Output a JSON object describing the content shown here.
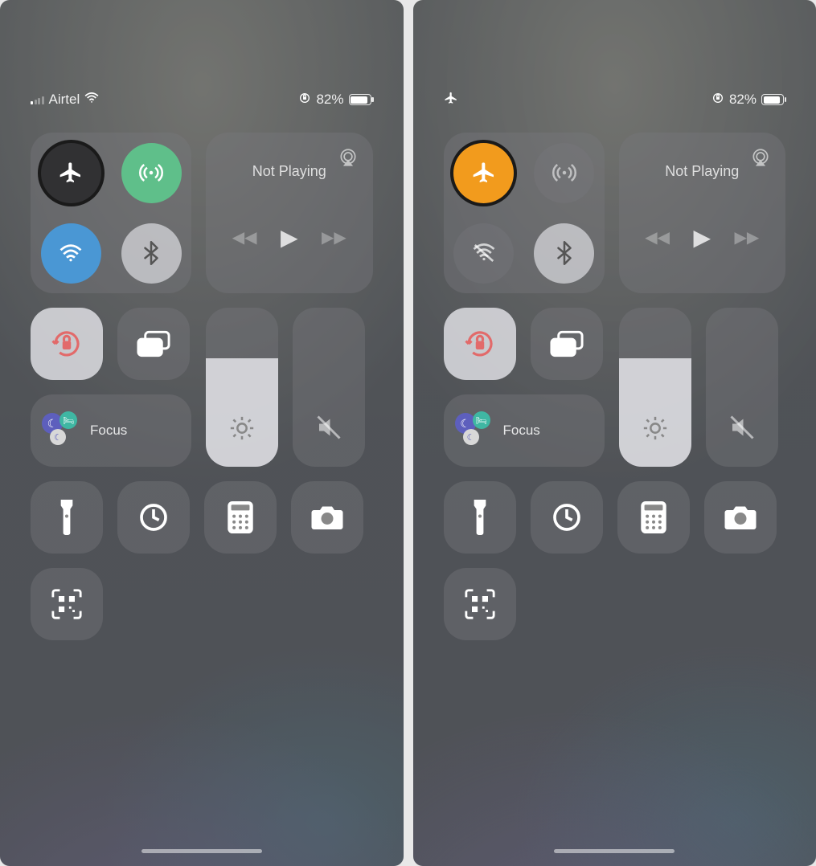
{
  "panes": [
    {
      "status": {
        "carrier": "Airtel",
        "showSignal": true,
        "battery": "82%",
        "airplaneOn": false
      },
      "media": {
        "title": "Not Playing"
      },
      "airplane": {
        "on": false
      },
      "cellular": {
        "on": true
      },
      "wifi": {
        "on": true
      },
      "bluetooth": {
        "on": true
      },
      "focus": {
        "label": "Focus"
      },
      "brightnessPct": 68,
      "volumePct": 0
    },
    {
      "status": {
        "carrier": "",
        "showSignal": false,
        "battery": "82%",
        "airplaneOn": true
      },
      "media": {
        "title": "Not Playing"
      },
      "airplane": {
        "on": true
      },
      "cellular": {
        "on": false
      },
      "wifi": {
        "on": false
      },
      "bluetooth": {
        "on": true
      },
      "focus": {
        "label": "Focus"
      },
      "brightnessPct": 68,
      "volumePct": 0
    }
  ],
  "colors": {
    "orange": "#f29b1d",
    "green": "#5fbf8a",
    "blue": "#4a97d4"
  }
}
